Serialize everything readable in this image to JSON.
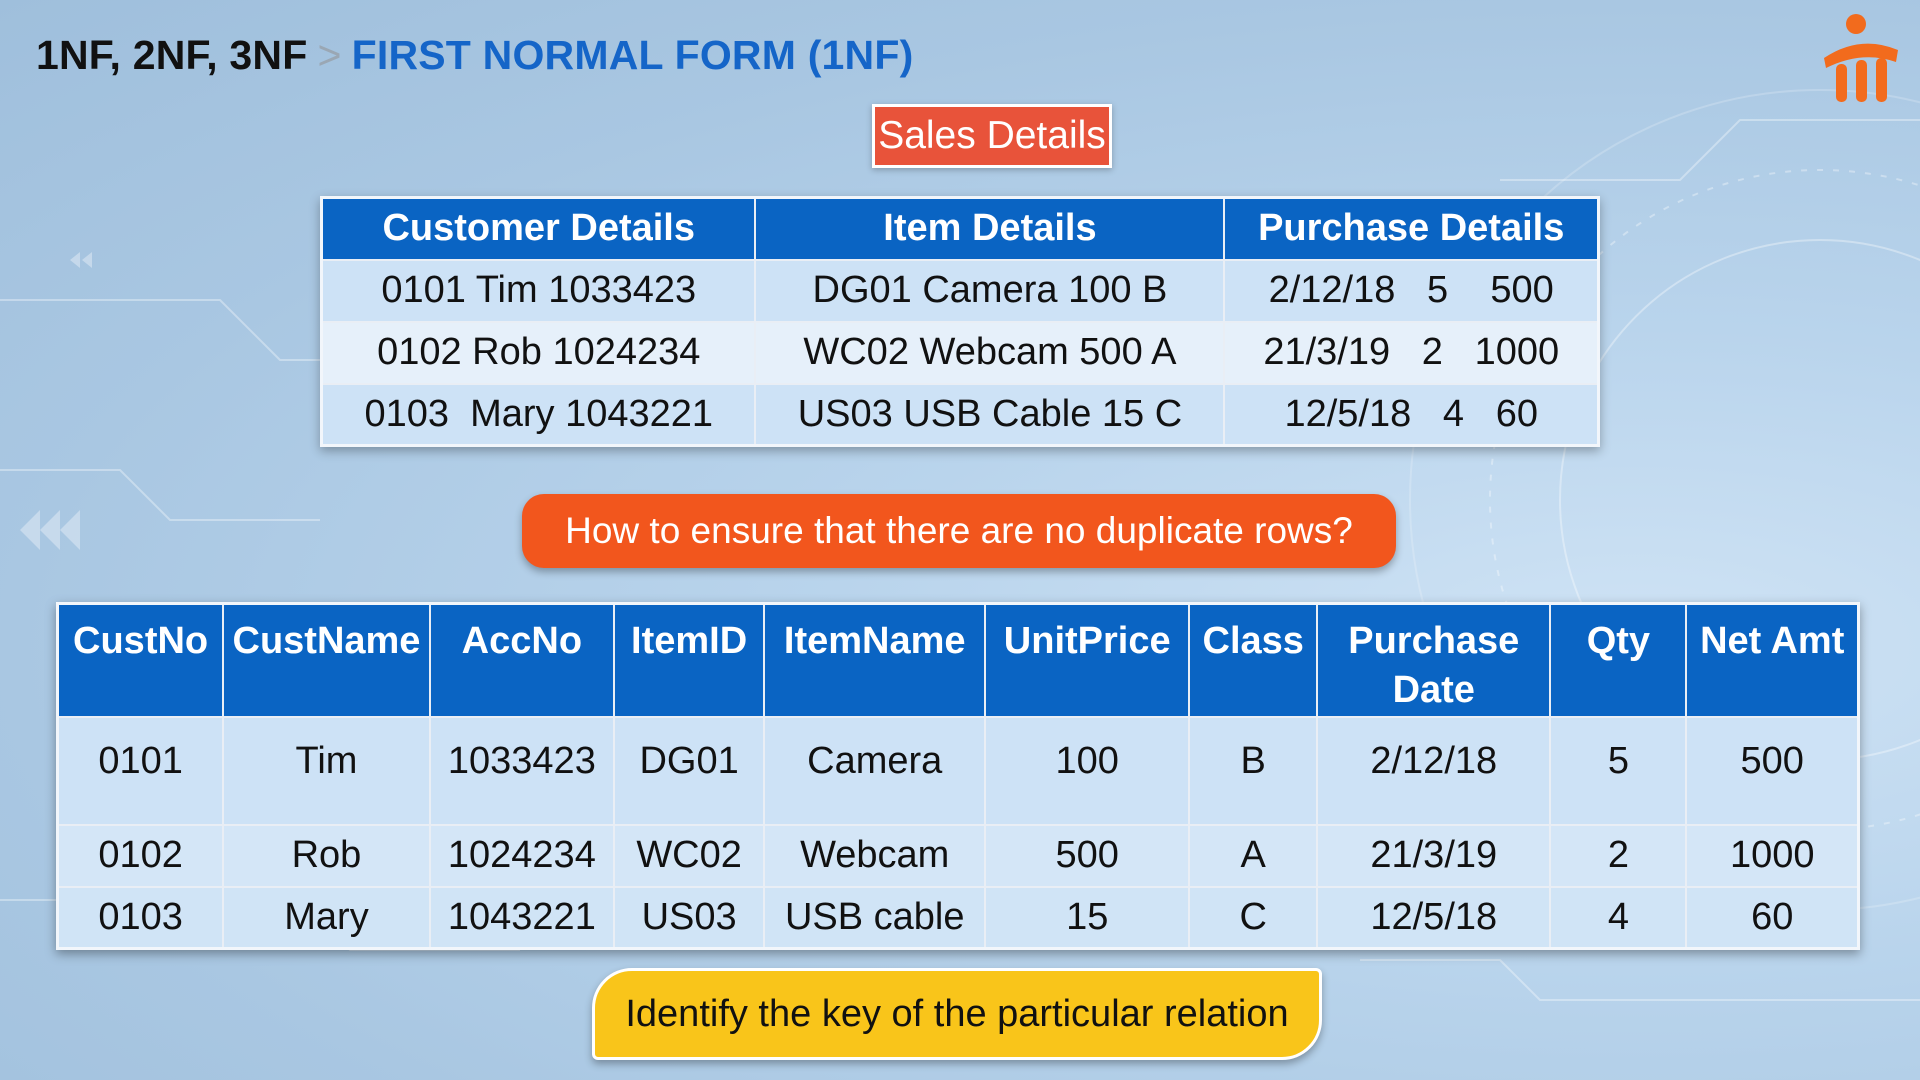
{
  "breadcrumb": {
    "previous": "1NF, 2NF, 3NF",
    "separator": ">",
    "current": "FIRST NORMAL FORM (1NF)"
  },
  "logo": {
    "icon": "brand-logo-icon",
    "color": "#f26b1d"
  },
  "sales_table": {
    "caption": "Sales Details",
    "headers": [
      "Customer Details",
      "Item Details",
      "Purchase Details"
    ],
    "rows": [
      [
        "0101 Tim 1033423",
        "DG01 Camera 100 B",
        "2/12/18   5    500"
      ],
      [
        "0102 Rob 1024234",
        "WC02 Webcam 500 A",
        "21/3/19   2   1000"
      ],
      [
        "0103  Mary 1043221",
        "US03 USB Cable 15 C",
        "12/5/18   4   60"
      ]
    ]
  },
  "question": "How to ensure that there are no duplicate rows?",
  "normalized_table": {
    "headers": [
      "CustNo",
      "CustName",
      "AccNo",
      "ItemID",
      "ItemName",
      "UnitPrice",
      "Class",
      "Purchase Date",
      "Qty",
      "Net Amt"
    ],
    "rows": [
      [
        "0101",
        "Tim",
        "1033423",
        "DG01",
        "Camera",
        "100",
        "B",
        "2/12/18",
        "5",
        "500"
      ],
      [
        "0102",
        "Rob",
        "1024234",
        "WC02",
        "Webcam",
        "500",
        "A",
        "21/3/19",
        "2",
        "1000"
      ],
      [
        "0103",
        "Mary",
        "1043221",
        "US03",
        "USB cable",
        "15",
        "C",
        "12/5/18",
        "4",
        "60"
      ]
    ]
  },
  "hint": "Identify the key of the particular relation",
  "colors": {
    "header_blue": "#0a64c3",
    "accent_blue": "#1565c8",
    "caption_red": "#e8533a",
    "question_orange": "#f2561d",
    "hint_yellow": "#f9c51a"
  }
}
